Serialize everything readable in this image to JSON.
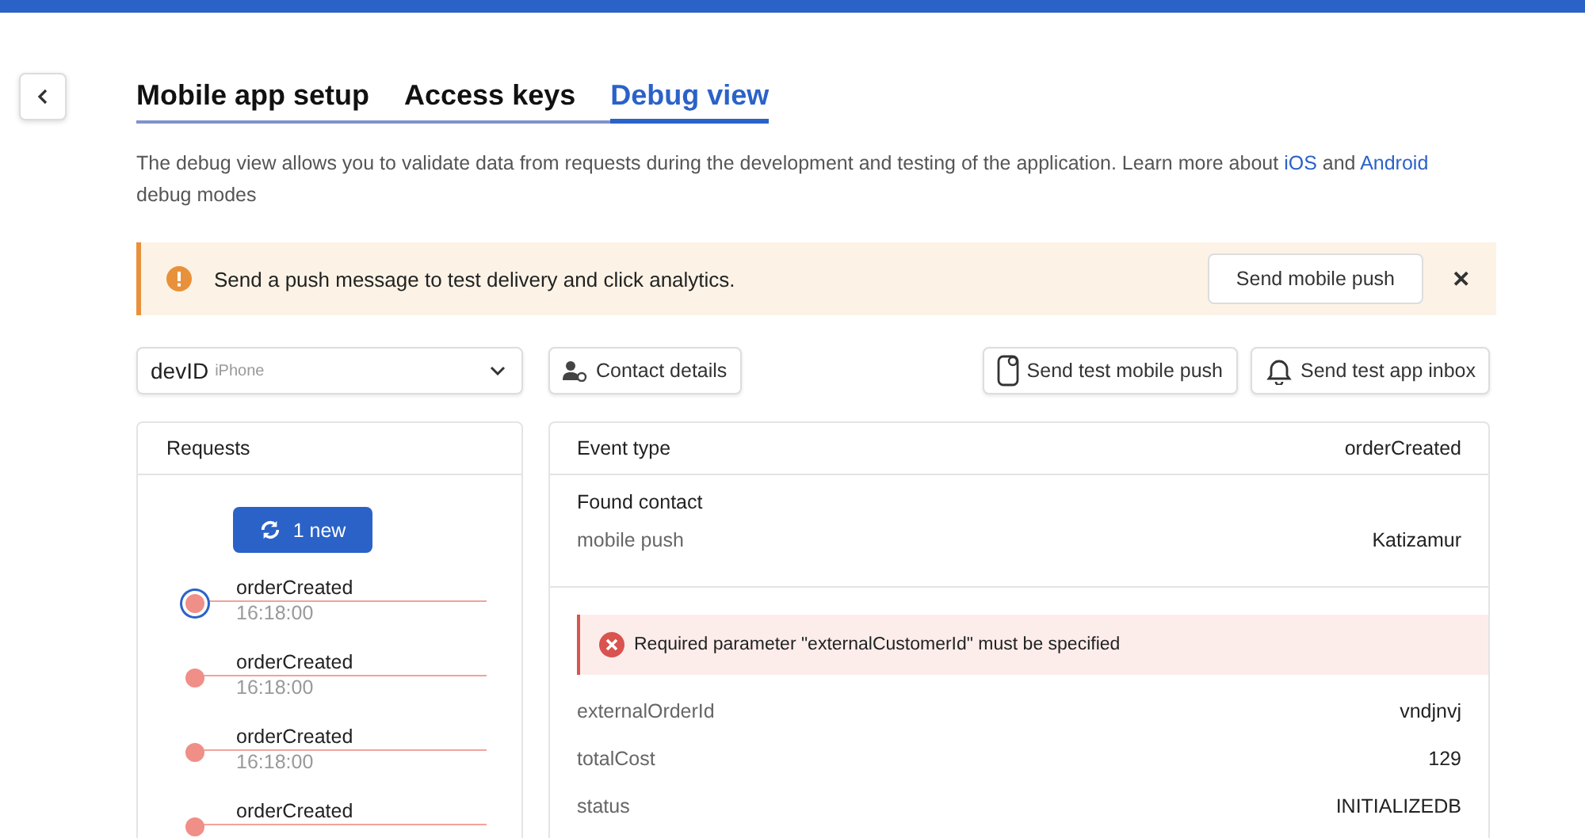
{
  "tabs": [
    {
      "label": "Mobile app setup",
      "selected": false
    },
    {
      "label": "Access keys",
      "selected": false
    },
    {
      "label": "Debug view",
      "selected": true
    }
  ],
  "description": {
    "text": "The debug view allows you to validate data from requests during the development and testing of the application. Learn more about",
    "link1": "iOS",
    "middle": "and",
    "link2": "Android",
    "end": "debug modes"
  },
  "alert": {
    "message": "Send a push message to test delivery and click analytics.",
    "button": "Send mobile push",
    "close": "✕"
  },
  "device_select": {
    "value": "devID",
    "hint": "iPhone"
  },
  "contact_button": "Contact details",
  "actions": [
    "Send test mobile push",
    "Send test app inbox"
  ],
  "requests": {
    "title": "Requests",
    "new_button": "1 new",
    "items": [
      {
        "name": "orderCreated",
        "time": "16:18:00",
        "selected": true
      },
      {
        "name": "orderCreated",
        "time": "16:18:00",
        "selected": false
      },
      {
        "name": "orderCreated",
        "time": "16:18:00",
        "selected": false
      },
      {
        "name": "orderCreated",
        "selected": false
      }
    ]
  },
  "details": {
    "event_label": "Event type",
    "event_value": "orderCreated",
    "contact_title": "Found contact",
    "contact_rows": [
      {
        "label": "mobile push",
        "value": "Katizamur"
      }
    ],
    "error": "Required parameter \"externalCustomerId\" must be specified",
    "fields": [
      {
        "label": "externalOrderId",
        "value": "vndjnvj"
      },
      {
        "label": "totalCost",
        "value": "129"
      },
      {
        "label": "status",
        "value": "INITIALIZEDB"
      }
    ]
  }
}
